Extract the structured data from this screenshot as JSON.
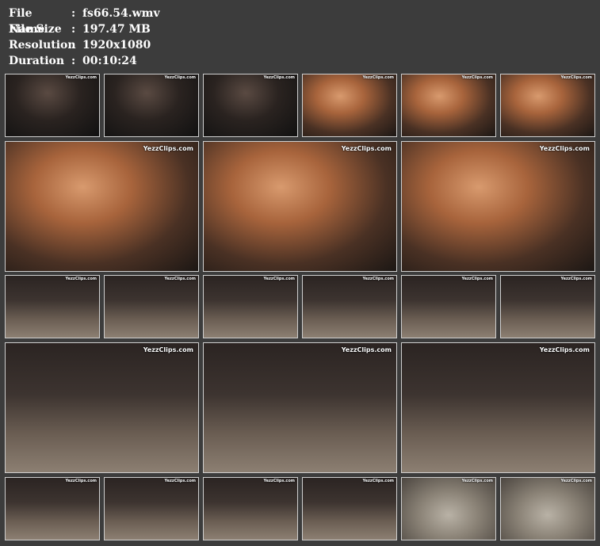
{
  "file_info": [
    {
      "label": "File Name",
      "sep": ":",
      "value": "fs66.54.wmv"
    },
    {
      "label": "File Size",
      "sep": ":",
      "value": "197.47 MB"
    },
    {
      "label": "Resolution",
      "sep": ":",
      "value": "1920x1080"
    },
    {
      "label": "Duration",
      "sep": ":",
      "value": "00:10:24"
    }
  ],
  "watermark": "YezzClips.com",
  "colors": {
    "background": "#3c3c3c",
    "thumb_border": "#cfcfcf",
    "text": "#ffffff"
  },
  "thumbnails": [
    {
      "row": 1,
      "index": 1,
      "scene": "dark"
    },
    {
      "row": 1,
      "index": 2,
      "scene": "dark"
    },
    {
      "row": 1,
      "index": 3,
      "scene": "dark"
    },
    {
      "row": 1,
      "index": 4,
      "scene": "warm"
    },
    {
      "row": 1,
      "index": 5,
      "scene": "warm"
    },
    {
      "row": 1,
      "index": 6,
      "scene": "warm"
    },
    {
      "row": 2,
      "index": 1,
      "scene": "warm"
    },
    {
      "row": 2,
      "index": 2,
      "scene": "warm"
    },
    {
      "row": 2,
      "index": 3,
      "scene": "warm"
    },
    {
      "row": 3,
      "index": 1,
      "scene": "room"
    },
    {
      "row": 3,
      "index": 2,
      "scene": "room"
    },
    {
      "row": 3,
      "index": 3,
      "scene": "room"
    },
    {
      "row": 3,
      "index": 4,
      "scene": "room"
    },
    {
      "row": 3,
      "index": 5,
      "scene": "room"
    },
    {
      "row": 3,
      "index": 6,
      "scene": "room"
    },
    {
      "row": 4,
      "index": 1,
      "scene": "room"
    },
    {
      "row": 4,
      "index": 2,
      "scene": "room"
    },
    {
      "row": 4,
      "index": 3,
      "scene": "room"
    },
    {
      "row": 5,
      "index": 1,
      "scene": "room"
    },
    {
      "row": 5,
      "index": 2,
      "scene": "room"
    },
    {
      "row": 5,
      "index": 3,
      "scene": "room"
    },
    {
      "row": 5,
      "index": 4,
      "scene": "room"
    },
    {
      "row": 5,
      "index": 5,
      "scene": "floor"
    },
    {
      "row": 5,
      "index": 6,
      "scene": "floor"
    }
  ]
}
